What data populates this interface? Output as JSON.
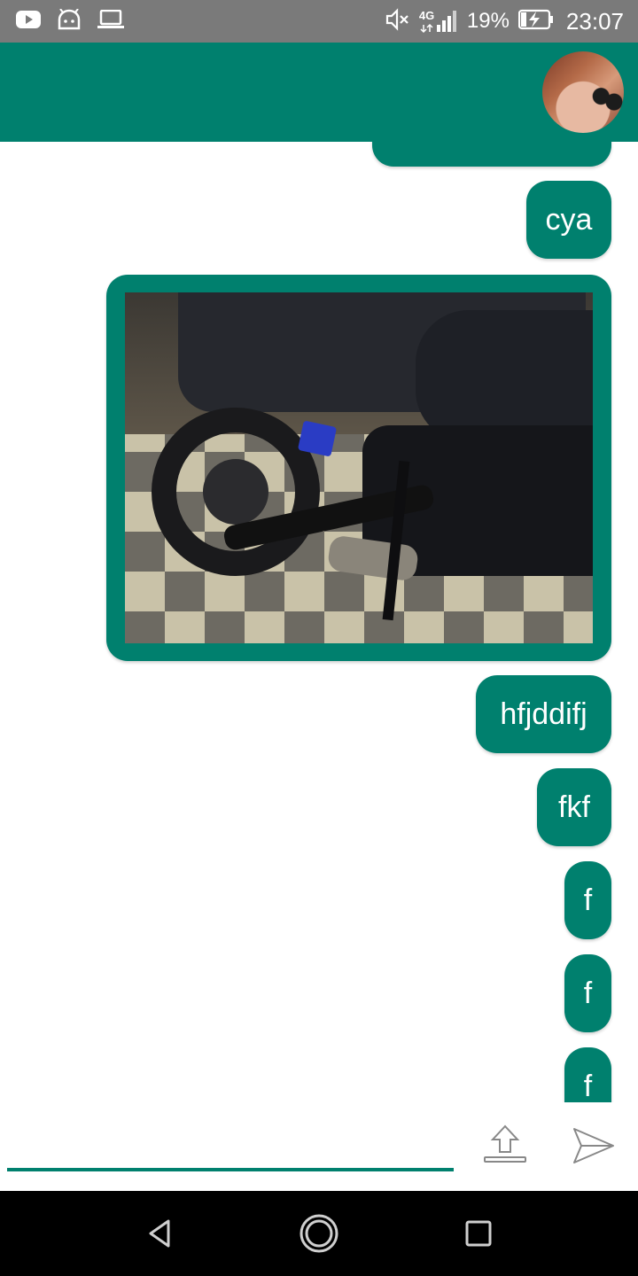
{
  "status_bar": {
    "battery": "19%",
    "time": "23:07",
    "network": "4G",
    "icons_left": [
      "youtube-icon",
      "android-icon",
      "laptop-icon"
    ],
    "icons_right": [
      "mute-icon",
      "signal-icon",
      "battery-charging-icon"
    ]
  },
  "header": {
    "avatar": "contact-avatar"
  },
  "messages": [
    {
      "type": "text",
      "text": ""
    },
    {
      "type": "text",
      "text": "cya"
    },
    {
      "type": "image",
      "content": "motorcycle-photo"
    },
    {
      "type": "text",
      "text": "hfjddifj"
    },
    {
      "type": "text",
      "text": "fkf"
    },
    {
      "type": "text",
      "text": "f"
    },
    {
      "type": "text",
      "text": "f"
    },
    {
      "type": "text",
      "text": "f"
    }
  ],
  "composer": {
    "value": "",
    "placeholder": "",
    "upload_icon": "upload-icon",
    "send_icon": "send-icon"
  },
  "nav": {
    "icons": [
      "back-icon",
      "home-icon",
      "recents-icon"
    ]
  },
  "colors": {
    "accent": "#00806e",
    "status_bar": "#7a7a7a",
    "nav_bar": "#000000"
  }
}
